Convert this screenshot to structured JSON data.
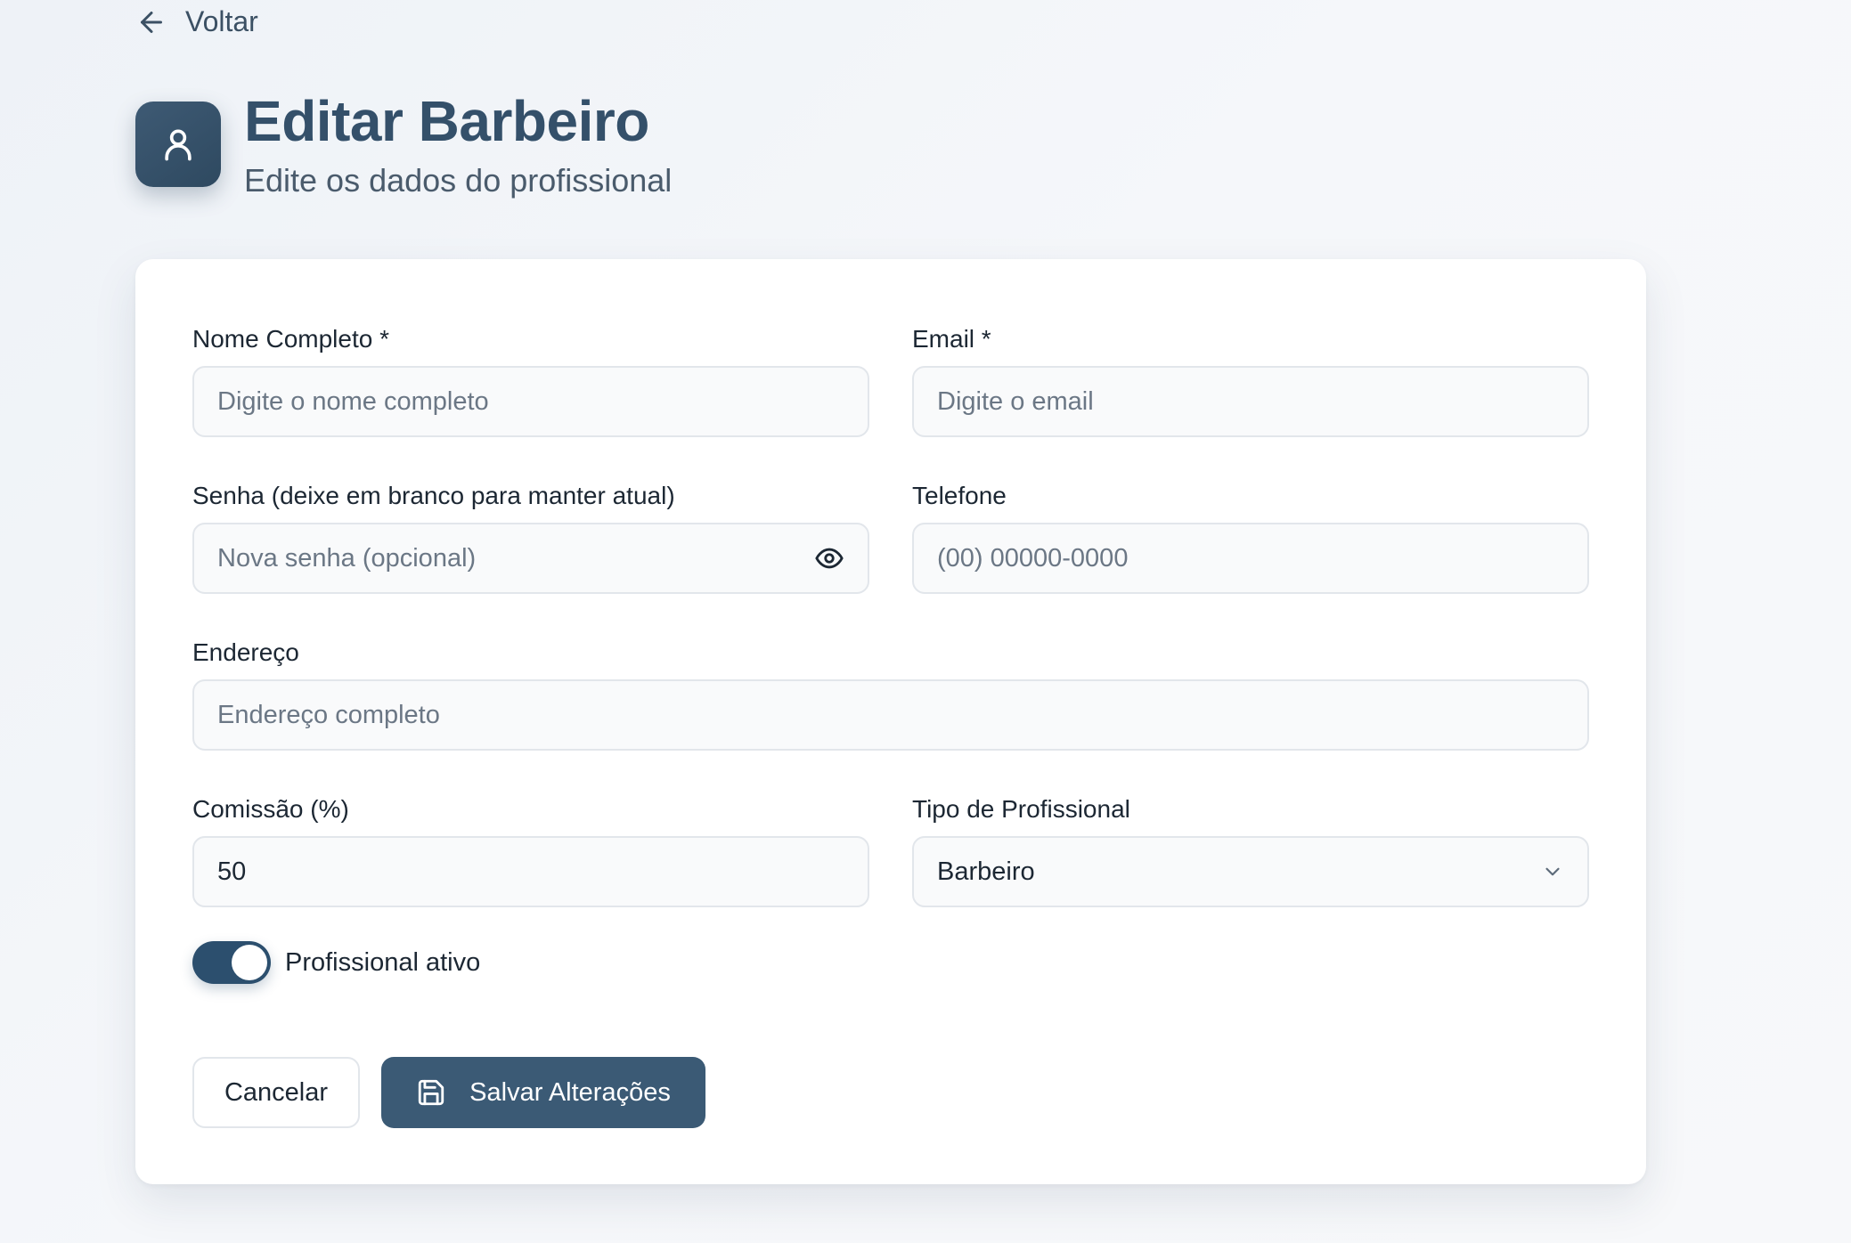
{
  "nav": {
    "back_label": "Voltar"
  },
  "header": {
    "title": "Editar Barbeiro",
    "subtitle": "Edite os dados do profissional"
  },
  "form": {
    "name": {
      "label": "Nome Completo *",
      "placeholder": "Digite o nome completo",
      "value": ""
    },
    "email": {
      "label": "Email *",
      "placeholder": "Digite o email",
      "value": ""
    },
    "password": {
      "label": "Senha (deixe em branco para manter atual)",
      "placeholder": "Nova senha (opcional)",
      "value": ""
    },
    "phone": {
      "label": "Telefone",
      "placeholder": "(00) 00000-0000",
      "value": ""
    },
    "address": {
      "label": "Endereço",
      "placeholder": "Endereço completo",
      "value": ""
    },
    "commission": {
      "label": "Comissão (%)",
      "value": "50"
    },
    "professional_type": {
      "label": "Tipo de Profissional",
      "selected": "Barbeiro"
    },
    "active_toggle": {
      "label": "Profissional ativo",
      "on": true
    }
  },
  "actions": {
    "cancel_label": "Cancelar",
    "save_label": "Salvar Alterações"
  },
  "icons": {
    "back": "arrow-left-icon",
    "avatar": "user-icon",
    "password_visibility": "eye-icon",
    "select": "chevron-down-icon",
    "save": "save-icon"
  },
  "colors": {
    "primary": "#3b5a75",
    "toggle_on": "#2c4f6e",
    "title": "#34506a"
  }
}
